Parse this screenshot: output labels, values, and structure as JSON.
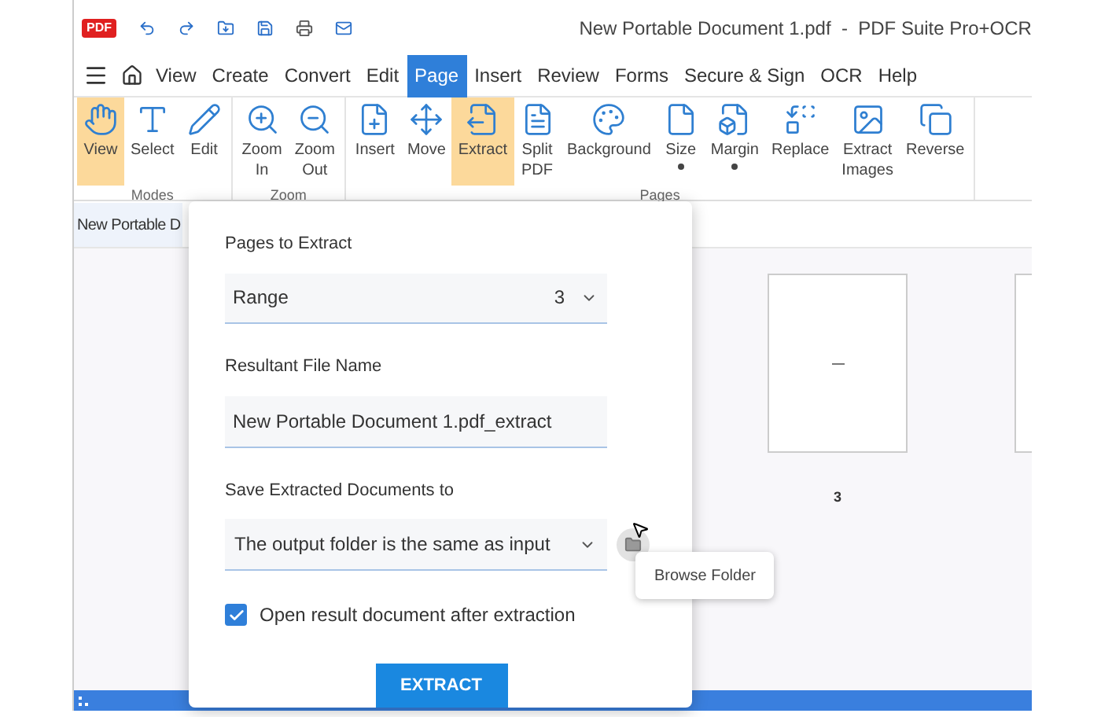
{
  "window": {
    "title": "New Portable Document 1.pdf  -  PDF Suite Pro+OCR",
    "logo": "PDF"
  },
  "menu": [
    {
      "label": "View",
      "selected": false
    },
    {
      "label": "Create",
      "selected": false
    },
    {
      "label": "Convert",
      "selected": false
    },
    {
      "label": "Edit",
      "selected": false
    },
    {
      "label": "Page",
      "selected": true
    },
    {
      "label": "Insert",
      "selected": false
    },
    {
      "label": "Review",
      "selected": false
    },
    {
      "label": "Forms",
      "selected": false
    },
    {
      "label": "Secure & Sign",
      "selected": false
    },
    {
      "label": "OCR",
      "selected": false
    },
    {
      "label": "Help",
      "selected": false
    }
  ],
  "ribbon": [
    {
      "label": "Modes",
      "buttons": [
        {
          "label": "View",
          "selected": true,
          "dropdown": false
        },
        {
          "label": "Select",
          "selected": false,
          "dropdown": false
        },
        {
          "label": "Edit",
          "selected": false,
          "dropdown": false
        }
      ]
    },
    {
      "label": "Zoom",
      "buttons": [
        {
          "label": "Zoom In",
          "selected": false,
          "dropdown": false
        },
        {
          "label": "Zoom Out",
          "selected": false,
          "dropdown": false
        }
      ]
    },
    {
      "label": "Pages",
      "buttons": [
        {
          "label": "Insert",
          "selected": false,
          "dropdown": false
        },
        {
          "label": "Move",
          "selected": false,
          "dropdown": false
        },
        {
          "label": "Extract",
          "selected": true,
          "dropdown": false
        },
        {
          "label": "Split PDF",
          "selected": false,
          "dropdown": false
        },
        {
          "label": "Background",
          "selected": false,
          "dropdown": false
        },
        {
          "label": "Size",
          "selected": false,
          "dropdown": true
        },
        {
          "label": "Margin",
          "selected": false,
          "dropdown": true
        },
        {
          "label": "Replace",
          "selected": false,
          "dropdown": false
        },
        {
          "label": "Extract Images",
          "selected": false,
          "dropdown": false
        },
        {
          "label": "Reverse",
          "selected": false,
          "dropdown": false
        }
      ]
    }
  ],
  "document_tab": "New Portable D",
  "thumbnails": [
    {
      "page_number": "3"
    }
  ],
  "dialog": {
    "pages_label": "Pages to Extract",
    "pages_mode": "Range",
    "pages_value": "3",
    "name_label": "Resultant File Name",
    "name_value": "New Portable Document 1.pdf_extract",
    "save_label": "Save Extracted Documents to",
    "save_value": "The output folder is the same as input",
    "open_after": {
      "label": "Open result document after extraction",
      "checked": true
    },
    "button": "EXTRACT"
  },
  "tooltip": "Browse Folder"
}
